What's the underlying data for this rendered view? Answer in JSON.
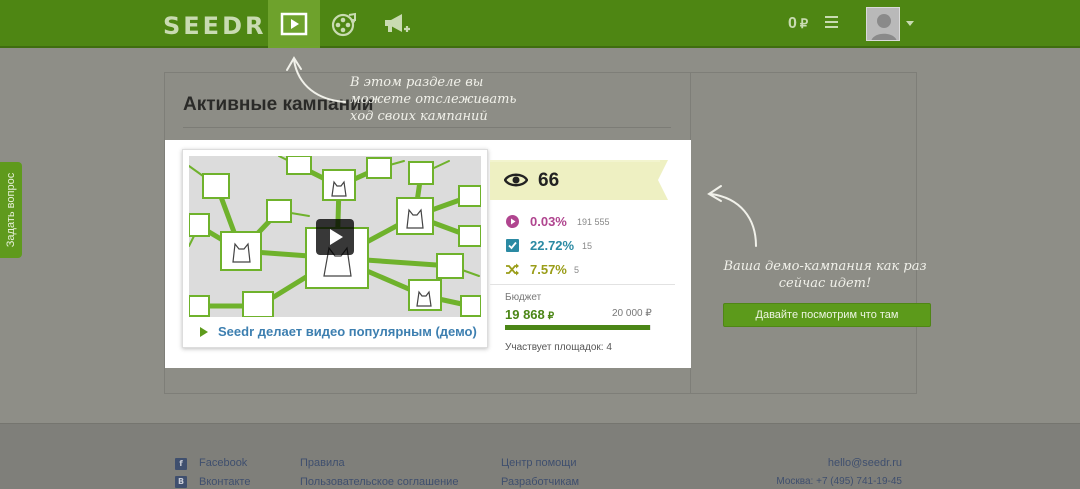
{
  "header": {
    "logo": "SEEDR",
    "nav": [
      {
        "name": "campaigns",
        "icon": "play-square-icon",
        "active": true
      },
      {
        "name": "videos",
        "icon": "film-reel-icon",
        "active": false
      },
      {
        "name": "promote",
        "icon": "megaphone-plus-icon",
        "active": false
      }
    ],
    "balance": "0",
    "currency": "₽",
    "accent": "#4e8613"
  },
  "sidebar_tab": {
    "label": "Задать вопрос"
  },
  "panel": {
    "title": "Активные кампании"
  },
  "campaign": {
    "video_title": "Seedr делает видео популярным (демо)",
    "views": "66",
    "stats": [
      {
        "icon": "play-circle-icon",
        "percent": "0.03%",
        "count": "191 555",
        "color": "#b0458f"
      },
      {
        "icon": "checkbox-icon",
        "percent": "22.72%",
        "count": "15",
        "color": "#2b8aa3"
      },
      {
        "icon": "shuffle-icon",
        "percent": "7.57%",
        "count": "5",
        "color": "#9a9d19"
      }
    ],
    "budget": {
      "label": "Бюджет",
      "spent": "19 868",
      "total": "20 000 ₽",
      "currency": "₽",
      "fraction": 0.993
    },
    "platforms": "Участвует площадок: 4"
  },
  "hints": {
    "top_lines": [
      "В этом разделе вы",
      "можете отслеживать",
      "ход своих кампаний"
    ],
    "right_lines": [
      "Ваша демо-кампания как раз",
      "сейчас идет!"
    ]
  },
  "cta_label": "Давайте посмотрим что там",
  "footer": {
    "social": [
      {
        "icon": "facebook-icon",
        "glyph": "f",
        "label": "Facebook"
      },
      {
        "icon": "vkontakte-icon",
        "glyph": "В",
        "label": "Вконтакте"
      }
    ],
    "col2": [
      "Правила",
      "Пользовательское соглашение"
    ],
    "col3": [
      "Центр помощи",
      "Разработчикам"
    ],
    "email": "hello@seedr.ru",
    "phone": "Москва: +7 (495) 741-19-45"
  }
}
